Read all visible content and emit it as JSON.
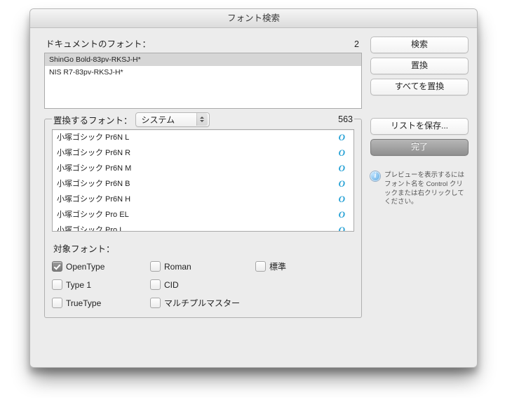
{
  "title": "フォント検索",
  "doc": {
    "label": "ドキュメントのフォント：",
    "count": "2",
    "items": [
      {
        "name": "ShinGo Bold-83pv-RKSJ-H*",
        "selected": true
      },
      {
        "name": "NIS R7-83pv-RKSJ-H*",
        "selected": false
      }
    ]
  },
  "replace": {
    "label": "置換するフォント：",
    "source_selected": "システム",
    "count": "563",
    "items": [
      {
        "name": "小塚ゴシック Pr6N L"
      },
      {
        "name": "小塚ゴシック Pr6N R"
      },
      {
        "name": "小塚ゴシック Pr6N M"
      },
      {
        "name": "小塚ゴシック Pr6N B"
      },
      {
        "name": "小塚ゴシック Pr6N H"
      },
      {
        "name": "小塚ゴシック Pro EL"
      },
      {
        "name": "小塚ゴシック Pro L"
      }
    ]
  },
  "targets": {
    "label": "対象フォント：",
    "items": [
      {
        "id": "opentype",
        "label": "OpenType",
        "checked": true
      },
      {
        "id": "roman",
        "label": "Roman",
        "checked": false
      },
      {
        "id": "standard",
        "label": "標準",
        "checked": false
      },
      {
        "id": "type1",
        "label": "Type 1",
        "checked": false
      },
      {
        "id": "cid",
        "label": "CID",
        "checked": false
      },
      {
        "id": "",
        "label": "",
        "checked": null
      },
      {
        "id": "truetype",
        "label": "TrueType",
        "checked": false
      },
      {
        "id": "mm",
        "label": "マルチプルマスター",
        "checked": false
      }
    ]
  },
  "buttons": {
    "search": "検索",
    "replace": "置換",
    "replace_all": "すべてを置換",
    "save_list": "リストを保存...",
    "done": "完了"
  },
  "hint": "プレビューを表示するにはフォント名を Control クリックまたは右クリックしてください。"
}
